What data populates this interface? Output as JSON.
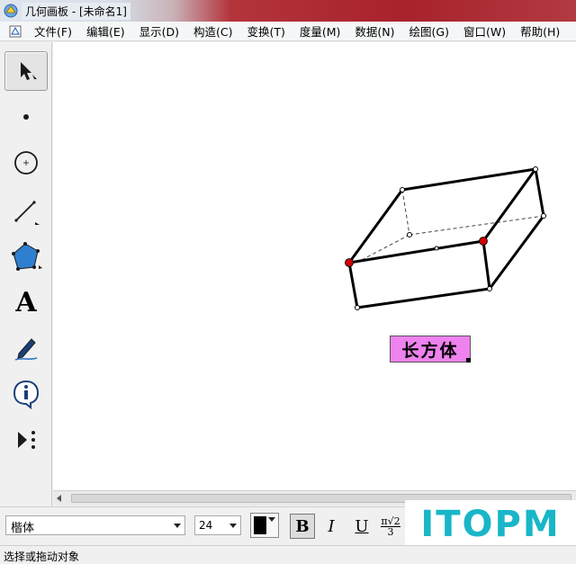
{
  "window": {
    "title": "几何画板 - [未命名1]"
  },
  "menubar": {
    "items": [
      "文件(F)",
      "编辑(E)",
      "显示(D)",
      "构造(C)",
      "变换(T)",
      "度量(M)",
      "数据(N)",
      "绘图(G)",
      "窗口(W)",
      "帮助(H)"
    ]
  },
  "toolbox": {
    "tools": [
      {
        "name": "select-arrow-tool",
        "selected": true
      },
      {
        "name": "point-tool"
      },
      {
        "name": "compass-tool"
      },
      {
        "name": "straightedge-tool"
      },
      {
        "name": "polygon-tool"
      },
      {
        "name": "text-tool",
        "glyph": "A"
      },
      {
        "name": "marker-tool"
      },
      {
        "name": "information-tool"
      },
      {
        "name": "custom-tool"
      }
    ]
  },
  "canvas": {
    "label_text": "长方体",
    "label_color": "#ee82ee",
    "highlight_point_color": "#cc0000"
  },
  "textbar": {
    "font": "楷体",
    "size": "24",
    "bold": "B",
    "italic": "I",
    "underline": "U",
    "math_numerator": "π√2",
    "math_denominator": "3"
  },
  "watermark": {
    "text": "ITOPM",
    "color": "#19b6c8"
  },
  "statusbar": {
    "text": "选择或拖动对象"
  }
}
